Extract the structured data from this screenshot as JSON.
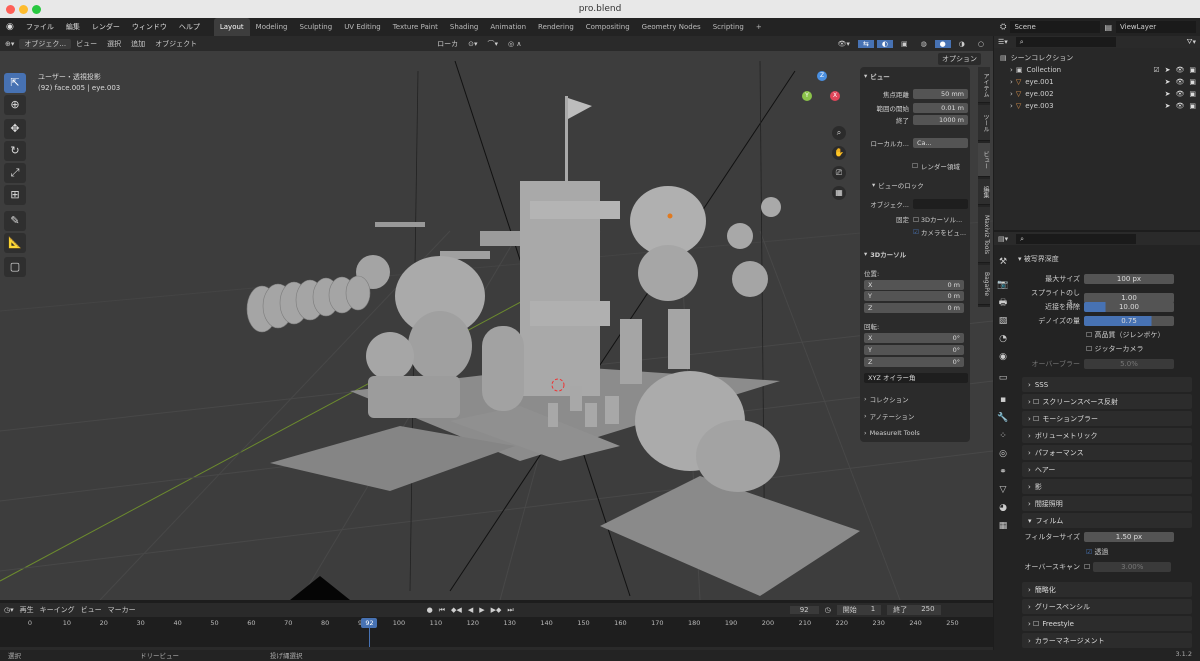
{
  "window": {
    "title": "pro.blend",
    "version": "3.1.2"
  },
  "menu": [
    "ファイル",
    "編集",
    "レンダー",
    "ウィンドウ",
    "ヘルプ"
  ],
  "workspaces": [
    "Layout",
    "Modeling",
    "Sculpting",
    "UV Editing",
    "Texture Paint",
    "Shading",
    "Animation",
    "Rendering",
    "Compositing",
    "Geometry Nodes",
    "Scripting"
  ],
  "scene": {
    "name": "Scene",
    "viewlayer": "ViewLayer"
  },
  "viewport_header": {
    "mode": "オブジェク...",
    "view": "ビュー",
    "select": "選択",
    "add": "追加",
    "object": "オブジェクト",
    "orientation": "ローカ",
    "options": "オプション"
  },
  "viewport": {
    "view_name": "ユーザー・透視投影",
    "object_info": "(92) face.005 | eye.003"
  },
  "npanel": {
    "view_header": "ビュー",
    "focal_label": "焦点距離",
    "focal": "50 mm",
    "clip_start_label": "範囲の開始",
    "clip_start": "0.01 m",
    "clip_end_label": "終了",
    "clip_end": "1000 m",
    "local_camera_label": "ローカルカ...",
    "local_camera": "Ca...",
    "render_region": "レンダー領域",
    "view_lock_header": "ビューのロック",
    "object_label": "オブジェク...",
    "lock_label": "固定",
    "lock_3d_cursor": "3Dカーソル...",
    "lock_camera": "カメラをビュ...",
    "cursor_header": "3Dカーソル",
    "location_label": "位置:",
    "x": "X",
    "y": "Y",
    "z": "Z",
    "loc_x": "0 m",
    "loc_y": "0 m",
    "loc_z": "0 m",
    "rotation_label": "回転:",
    "rot_x": "0°",
    "rot_y": "0°",
    "rot_z": "0°",
    "rotation_mode": "XYZ オイラー角",
    "collection": "コレクション",
    "annotation": "アノテーション",
    "measureit": "MeasureIt Tools"
  },
  "ntabs": [
    "アイテム",
    "ツール",
    "ビュー",
    "編集",
    "Maxiviz Tools",
    "BagaPie"
  ],
  "outliner": {
    "root": "シーンコレクション",
    "items": [
      {
        "name": "Collection"
      },
      {
        "name": "eye.001"
      },
      {
        "name": "eye.002"
      },
      {
        "name": "eye.003"
      }
    ]
  },
  "properties": {
    "dof_header": "被写界深度",
    "max_size_label": "最大サイズ",
    "max_size": "100 px",
    "sprite_label": "スプライトのしき...",
    "sprite": "1.00",
    "neighbor_label": "近接を排除",
    "neighbor": "10.00",
    "denoise_label": "デノイズの量",
    "denoise": "0.75",
    "high_quality": "高品質（ジレンボケ）",
    "jitter": "ジッターカメラ",
    "overblur_label": "オーバーブラー",
    "overblur": "5.0%",
    "sections": [
      "SSS",
      "スクリーンスペース反射",
      "モーションブラー",
      "ボリューメトリック",
      "パフォーマンス",
      "ヘアー",
      "影",
      "間接照明"
    ],
    "film_header": "フィルム",
    "filter_label": "フィルターサイズ",
    "filter": "1.50 px",
    "transparent": "透過",
    "overscan_label": "オーバースキャン",
    "overscan": "3.00%",
    "sections2": [
      "簡略化",
      "グリースペンシル",
      "Freestyle",
      "カラーマネージメント"
    ]
  },
  "timeline": {
    "playback": "再生",
    "keying": "キーイング",
    "view": "ビュー",
    "marker": "マーカー",
    "current": "92",
    "start_label": "開始",
    "start": "1",
    "end_label": "終了",
    "end": "250",
    "ticks": [
      "0",
      "10",
      "20",
      "30",
      "40",
      "50",
      "60",
      "70",
      "80",
      "90",
      "100",
      "110",
      "120",
      "130",
      "140",
      "150",
      "160",
      "170",
      "180",
      "190",
      "200",
      "210",
      "220",
      "230",
      "240",
      "250"
    ]
  },
  "statusbar": {
    "select": "選択",
    "dolly": "ドリービュー",
    "lasso": "投げ縄選択"
  },
  "colors": {
    "accent": "#4772b3",
    "x_axis": "#e0465a",
    "y_axis": "#8bc34a",
    "z_axis": "#4a90e2"
  }
}
